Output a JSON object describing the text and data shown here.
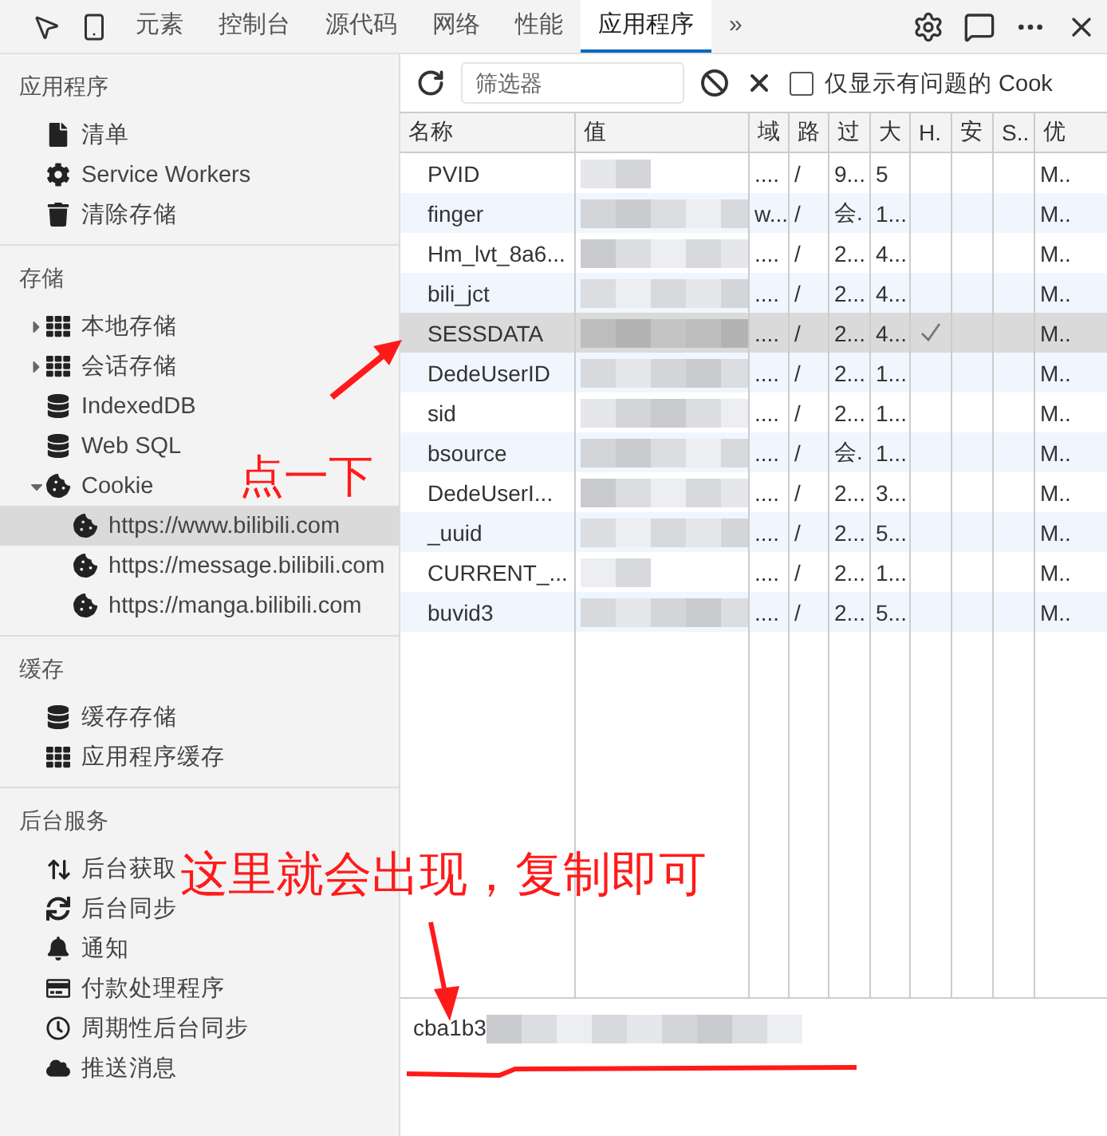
{
  "top_tabs": [
    {
      "label": "元素",
      "selected": false
    },
    {
      "label": "控制台",
      "selected": false
    },
    {
      "label": "源代码",
      "selected": false
    },
    {
      "label": "网络",
      "selected": false
    },
    {
      "label": "性能",
      "selected": false
    },
    {
      "label": "应用程序",
      "selected": true
    }
  ],
  "overflow_label": "»",
  "sidebar": {
    "sections": [
      {
        "title": "应用程序",
        "items": [
          {
            "label": "清单",
            "kind": "file",
            "selected": false
          },
          {
            "label": "Service Workers",
            "kind": "gear",
            "selected": false
          },
          {
            "label": "清除存储",
            "kind": "trash",
            "selected": false
          }
        ]
      },
      {
        "title": "存储",
        "items": [
          {
            "label": "本地存储",
            "kind": "grid",
            "expanded": false,
            "selected": false
          },
          {
            "label": "会话存储",
            "kind": "grid",
            "expanded": false,
            "selected": false
          },
          {
            "label": "IndexedDB",
            "kind": "database",
            "selected": false
          },
          {
            "label": "Web SQL",
            "kind": "database",
            "selected": false
          },
          {
            "label": "Cookie",
            "kind": "cookie",
            "expanded": true,
            "selected": false,
            "children": [
              {
                "label": "https://www.bilibili.com",
                "kind": "cookie",
                "selected": true
              },
              {
                "label": "https://message.bilibili.com",
                "kind": "cookie",
                "selected": false
              },
              {
                "label": "https://manga.bilibili.com",
                "kind": "cookie",
                "selected": false
              }
            ]
          }
        ]
      },
      {
        "title": "缓存",
        "items": [
          {
            "label": "缓存存储",
            "kind": "database",
            "selected": false
          },
          {
            "label": "应用程序缓存",
            "kind": "grid",
            "selected": false
          }
        ]
      },
      {
        "title": "后台服务",
        "items": [
          {
            "label": "后台获取",
            "kind": "arrows",
            "selected": false
          },
          {
            "label": "后台同步",
            "kind": "sync",
            "selected": false
          },
          {
            "label": "通知",
            "kind": "bell",
            "selected": false
          },
          {
            "label": "付款处理程序",
            "kind": "card",
            "selected": false
          },
          {
            "label": "周期性后台同步",
            "kind": "clock",
            "selected": false
          },
          {
            "label": "推送消息",
            "kind": "cloud",
            "selected": false
          }
        ]
      }
    ]
  },
  "toolbar": {
    "filter": {
      "placeholder": "筛选器"
    },
    "issues_only": {
      "label": "仅显示有问题的 Cook",
      "checked": false
    }
  },
  "table": {
    "columns": [
      "名称",
      "值",
      "域",
      "路",
      "过",
      "大",
      "H.",
      "安",
      "S..",
      "优"
    ],
    "rows": [
      {
        "name": "PVID",
        "domain": "....",
        "path": "/",
        "expires": "9...",
        "size": "5",
        "http_only": false,
        "priority": "M..",
        "selected": false
      },
      {
        "name": "finger",
        "domain": "w...",
        "path": "/",
        "expires": "会.",
        "size": "1...",
        "http_only": false,
        "priority": "M..",
        "selected": false
      },
      {
        "name": "Hm_lvt_8a6...",
        "domain": "....",
        "path": "/",
        "expires": "2...",
        "size": "4...",
        "http_only": false,
        "priority": "M..",
        "selected": false
      },
      {
        "name": "bili_jct",
        "domain": "....",
        "path": "/",
        "expires": "2...",
        "size": "4...",
        "http_only": false,
        "priority": "M..",
        "selected": false
      },
      {
        "name": "SESSDATA",
        "domain": "....",
        "path": "/",
        "expires": "2...",
        "size": "4...",
        "http_only": true,
        "priority": "M..",
        "selected": true
      },
      {
        "name": "DedeUserID",
        "domain": "....",
        "path": "/",
        "expires": "2...",
        "size": "1...",
        "http_only": false,
        "priority": "M..",
        "selected": false
      },
      {
        "name": "sid",
        "domain": "....",
        "path": "/",
        "expires": "2...",
        "size": "1...",
        "http_only": false,
        "priority": "M..",
        "selected": false
      },
      {
        "name": "bsource",
        "domain": "....",
        "path": "/",
        "expires": "会.",
        "size": "1...",
        "http_only": false,
        "priority": "M..",
        "selected": false
      },
      {
        "name": "DedeUserI...",
        "domain": "....",
        "path": "/",
        "expires": "2...",
        "size": "3...",
        "http_only": false,
        "priority": "M..",
        "selected": false
      },
      {
        "name": "_uuid",
        "domain": "....",
        "path": "/",
        "expires": "2...",
        "size": "5...",
        "http_only": false,
        "priority": "M..",
        "selected": false
      },
      {
        "name": "CURRENT_...",
        "domain": "....",
        "path": "/",
        "expires": "2...",
        "size": "1...",
        "http_only": false,
        "priority": "M..",
        "selected": false
      },
      {
        "name": "buvid3",
        "domain": "....",
        "path": "/",
        "expires": "2...",
        "size": "5...",
        "http_only": false,
        "priority": "M..",
        "selected": false
      }
    ]
  },
  "value_preview": {
    "text": "cba1b3"
  },
  "annotations": [
    {
      "text": "点一下"
    },
    {
      "text": "这里就会出现，复制即可"
    }
  ]
}
